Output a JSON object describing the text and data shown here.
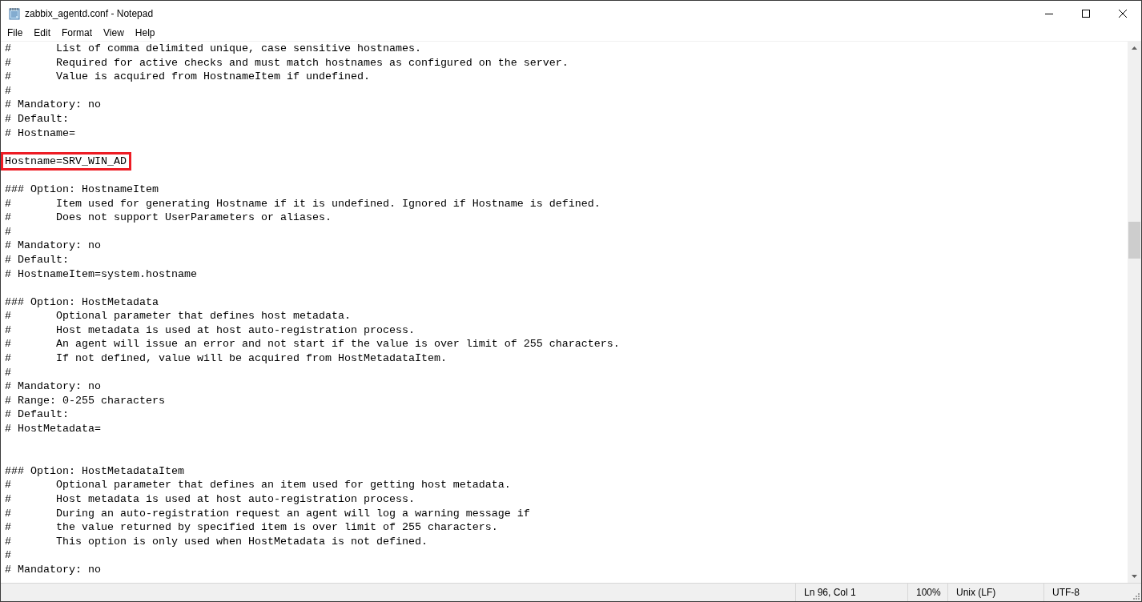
{
  "window": {
    "title": "zabbix_agentd.conf - Notepad"
  },
  "menu": [
    "File",
    "Edit",
    "Format",
    "View",
    "Help"
  ],
  "lines": [
    {
      "kind": "text",
      "text": "#       List of comma delimited unique, case sensitive hostnames.",
      "highlighted": false
    },
    {
      "kind": "text",
      "text": "#       Required for active checks and must match hostnames as configured on the server.",
      "highlighted": false
    },
    {
      "kind": "text",
      "text": "#       Value is acquired from HostnameItem if undefined.",
      "highlighted": false
    },
    {
      "kind": "text",
      "text": "#",
      "highlighted": false
    },
    {
      "kind": "text",
      "text": "# Mandatory: no",
      "highlighted": false
    },
    {
      "kind": "text",
      "text": "# Default:",
      "highlighted": false
    },
    {
      "kind": "text",
      "text": "# Hostname=",
      "highlighted": false
    },
    {
      "kind": "blank"
    },
    {
      "kind": "text",
      "text": "Hostname=SRV_WIN_AD",
      "highlighted": true
    },
    {
      "kind": "blank"
    },
    {
      "kind": "text",
      "text": "### Option: HostnameItem",
      "highlighted": false
    },
    {
      "kind": "text",
      "text": "#       Item used for generating Hostname if it is undefined. Ignored if Hostname is defined.",
      "highlighted": false
    },
    {
      "kind": "text",
      "text": "#       Does not support UserParameters or aliases.",
      "highlighted": false
    },
    {
      "kind": "text",
      "text": "#",
      "highlighted": false
    },
    {
      "kind": "text",
      "text": "# Mandatory: no",
      "highlighted": false
    },
    {
      "kind": "text",
      "text": "# Default:",
      "highlighted": false
    },
    {
      "kind": "text",
      "text": "# HostnameItem=system.hostname",
      "highlighted": false
    },
    {
      "kind": "blank"
    },
    {
      "kind": "text",
      "text": "### Option: HostMetadata",
      "highlighted": false
    },
    {
      "kind": "text",
      "text": "#       Optional parameter that defines host metadata.",
      "highlighted": false
    },
    {
      "kind": "text",
      "text": "#       Host metadata is used at host auto-registration process.",
      "highlighted": false
    },
    {
      "kind": "text",
      "text": "#       An agent will issue an error and not start if the value is over limit of 255 characters.",
      "highlighted": false
    },
    {
      "kind": "text",
      "text": "#       If not defined, value will be acquired from HostMetadataItem.",
      "highlighted": false
    },
    {
      "kind": "text",
      "text": "#",
      "highlighted": false
    },
    {
      "kind": "text",
      "text": "# Mandatory: no",
      "highlighted": false
    },
    {
      "kind": "text",
      "text": "# Range: 0-255 characters",
      "highlighted": false
    },
    {
      "kind": "text",
      "text": "# Default:",
      "highlighted": false
    },
    {
      "kind": "text",
      "text": "# HostMetadata=",
      "highlighted": false
    },
    {
      "kind": "blank"
    },
    {
      "kind": "blank"
    },
    {
      "kind": "text",
      "text": "### Option: HostMetadataItem",
      "highlighted": false
    },
    {
      "kind": "text",
      "text": "#       Optional parameter that defines an item used for getting host metadata.",
      "highlighted": false
    },
    {
      "kind": "text",
      "text": "#       Host metadata is used at host auto-registration process.",
      "highlighted": false
    },
    {
      "kind": "text",
      "text": "#       During an auto-registration request an agent will log a warning message if",
      "highlighted": false
    },
    {
      "kind": "text",
      "text": "#       the value returned by specified item is over limit of 255 characters.",
      "highlighted": false
    },
    {
      "kind": "text",
      "text": "#       This option is only used when HostMetadata is not defined.",
      "highlighted": false
    },
    {
      "kind": "text",
      "text": "#",
      "highlighted": false
    },
    {
      "kind": "text",
      "text": "# Mandatory: no",
      "highlighted": false
    }
  ],
  "status_bar": [
    "Ln 96, Col 1",
    "100%",
    "Unix (LF)",
    "UTF-8"
  ]
}
